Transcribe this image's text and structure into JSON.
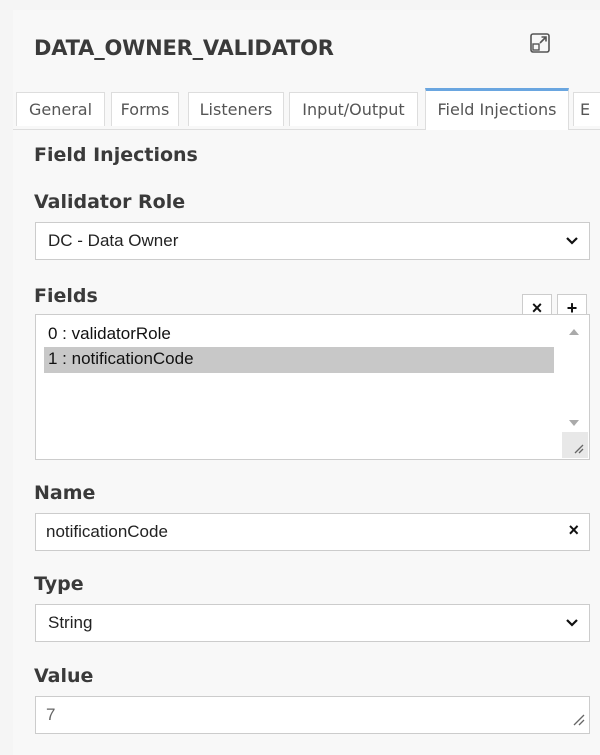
{
  "panel": {
    "title": "DATA_OWNER_VALIDATOR"
  },
  "icons": {
    "maximize": "maximize-icon",
    "tab_scroll_left": "chevron-left-icon",
    "select_chevron": "chevron-down-icon",
    "clear": "close-icon",
    "add": "plus-icon",
    "scroll_up": "scroll-up-icon",
    "scroll_down": "scroll-down-icon",
    "resize": "resize-grip-icon"
  },
  "tabs": {
    "scroll_left": "‹",
    "items": [
      {
        "label": "General"
      },
      {
        "label": "Forms"
      },
      {
        "label": "Listeners"
      },
      {
        "label": "Input/Output"
      },
      {
        "label": "Field Injections"
      },
      {
        "label": "E"
      }
    ],
    "active_label": "Field Injections"
  },
  "section": {
    "heading": "Field Injections"
  },
  "validator_role": {
    "label": "Validator Role",
    "selected": "DC - Data Owner"
  },
  "fields": {
    "label": "Fields",
    "remove_label": "×",
    "add_label": "+",
    "items": [
      {
        "text": "0 : validatorRole"
      },
      {
        "text": "1 : notificationCode"
      }
    ],
    "selected_text": "1 : notificationCode"
  },
  "name": {
    "label": "Name",
    "value": "notificationCode",
    "clear_label": "×"
  },
  "type": {
    "label": "Type",
    "selected": "String"
  },
  "value": {
    "label": "Value",
    "value": "7"
  },
  "colors": {
    "active_tab_accent": "#6aa6e0",
    "selected_row": "#c8c8c8",
    "panel_bg": "#f8f8f8"
  }
}
